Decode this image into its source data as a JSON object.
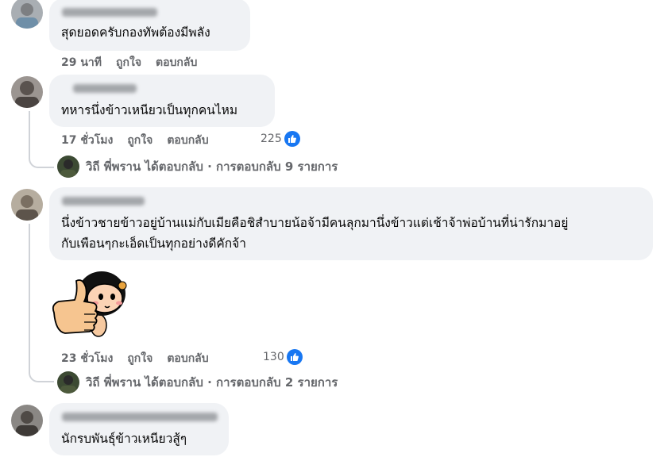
{
  "comments": [
    {
      "text": "สุดยอดครับกองทัพต้องมีพลัง",
      "time": "29 นาที",
      "like_label": "ถูกใจ",
      "reply_label": "ตอบกลับ"
    },
    {
      "text": "ทหารนึ่งข้าวเหนียวเป็นทุกคนไหม",
      "time": "17 ชั่วโมง",
      "like_label": "ถูกใจ",
      "reply_label": "ตอบกลับ",
      "reaction_count": "225",
      "replies_summary": {
        "replier_name": "วิถี พี่พราน",
        "action": "ได้ตอบกลับ",
        "separator": "·",
        "count_text": "การตอบกลับ 9 รายการ"
      }
    },
    {
      "text_line1": "นึ่งข้าวชายข้าวอยู่บ้านแม่กับเมียคือชิสำบายน้อจ้ามีคนลุกมานึ่งข้าวแต่เช้าจ้าพ่อบ้านที่น่ารักมาอยู่",
      "text_line2": "กับเพือนๆกะเอ็ดเป็นทุกอย่างดีคักจ้า",
      "sticker": "thumbs-up-girl-sticker",
      "time": "23 ชั่วโมง",
      "like_label": "ถูกใจ",
      "reply_label": "ตอบกลับ",
      "reaction_count": "130",
      "replies_summary": {
        "replier_name": "วิถี พี่พราน",
        "action": "ได้ตอบกลับ",
        "separator": "·",
        "count_text": "การตอบกลับ 2 รายการ"
      }
    },
    {
      "text": "นักรบพันธุ์ข้าวเหนียวสู้ๆ"
    }
  ],
  "icons": {
    "like": "thumbs-up-icon",
    "like_color": "#1877f2"
  }
}
